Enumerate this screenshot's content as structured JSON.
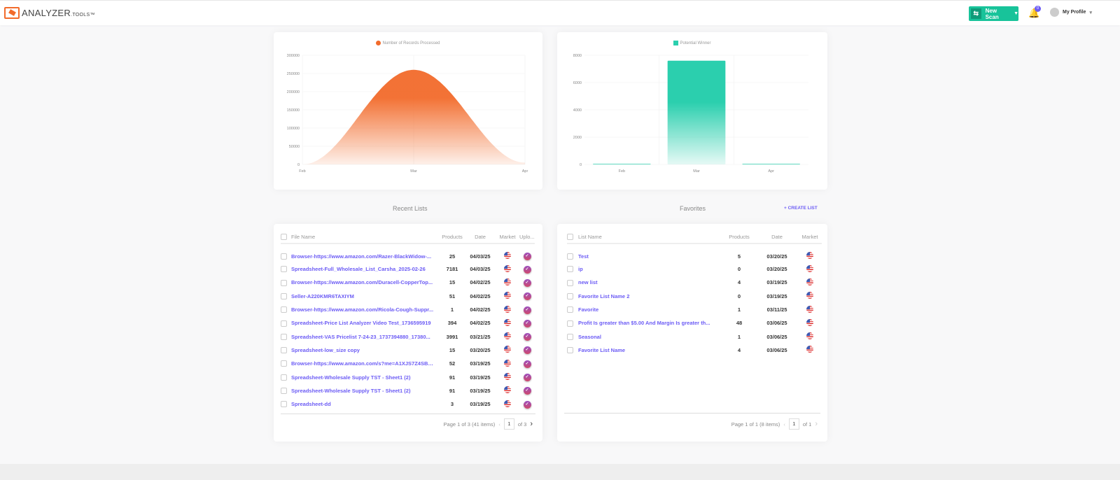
{
  "header": {
    "logo_text": "ANALYZER",
    "logo_suffix": ".TOOLS™",
    "new_scan": "New Scan",
    "notifications_count": "0",
    "profile": "My Profile"
  },
  "chart_data": [
    {
      "type": "area",
      "legend": "Number of Records Processed",
      "color": "#f26b2b",
      "categories": [
        "Feb",
        "Mar",
        "Apr"
      ],
      "values": [
        0,
        260000,
        5000
      ],
      "ylim": [
        0,
        300000
      ],
      "yticks": [
        "0",
        "50000",
        "100000",
        "150000",
        "200000",
        "250000",
        "300000"
      ],
      "grid": true,
      "legend_position": "top"
    },
    {
      "type": "bar",
      "legend": "Potential Winner",
      "color": "#2bcfae",
      "categories": [
        "Feb",
        "Mar",
        "Apr"
      ],
      "values": [
        0,
        7600,
        50
      ],
      "ylim": [
        0,
        8000
      ],
      "yticks": [
        "0",
        "2000",
        "4000",
        "6000",
        "8000"
      ],
      "grid": true,
      "legend_position": "top"
    }
  ],
  "recent": {
    "title": "Recent Lists",
    "headers": [
      "File Name",
      "Products",
      "Date",
      "Market",
      "Uplo..."
    ],
    "rows": [
      [
        "Browser-https://www.amazon.com/Razer-BlackWidow-...",
        "25",
        "04/03/25"
      ],
      [
        "Spreadsheet-Full_Wholesale_List_Carsha_2025-02-26",
        "7181",
        "04/03/25"
      ],
      [
        "Browser-https://www.amazon.com/Duracell-CopperTop...",
        "15",
        "04/02/25"
      ],
      [
        "Seller-A220KMR6TAXIYM",
        "51",
        "04/02/25"
      ],
      [
        "Browser-https://www.amazon.com/Ricola-Cough-Suppr...",
        "1",
        "04/02/25"
      ],
      [
        "Spreadsheet-Price List Analyzer Video Test_1736595919",
        "394",
        "04/02/25"
      ],
      [
        "Spreadsheet-VAS Pricelist 7-24-23_1737394880_17380...",
        "3991",
        "03/21/25"
      ],
      [
        "Spreadsheet-low_size copy",
        "15",
        "03/20/25"
      ],
      [
        "Browser-https://www.amazon.com/s?me=A1XJS7Z4SBL...",
        "52",
        "03/19/25"
      ],
      [
        "Spreadsheet-Wholesale Supply TST - Sheet1 (2)",
        "91",
        "03/19/25"
      ],
      [
        "Spreadsheet-Wholesale Supply TST - Sheet1 (2)",
        "91",
        "03/19/25"
      ],
      [
        "Spreadsheet-dd",
        "3",
        "03/19/25"
      ]
    ],
    "pager": {
      "summary": "Page 1 of 3 (41 items)",
      "page": "1",
      "of": "of 3"
    }
  },
  "favorites": {
    "title": "Favorites",
    "create": "+ CREATE LIST",
    "headers": [
      "List Name",
      "Products",
      "Date",
      "Market"
    ],
    "rows": [
      [
        "Test",
        "5",
        "03/20/25"
      ],
      [
        "ip",
        "0",
        "03/20/25"
      ],
      [
        "new list",
        "4",
        "03/19/25"
      ],
      [
        "Favorite List Name 2",
        "0",
        "03/19/25"
      ],
      [
        "Favorite",
        "1",
        "03/11/25"
      ],
      [
        "Profit Is greater than $5.00 And Margin Is greater th...",
        "48",
        "03/06/25"
      ],
      [
        "Seasonal",
        "1",
        "03/06/25"
      ],
      [
        "Favorite List Name",
        "4",
        "03/06/25"
      ]
    ],
    "pager": {
      "summary": "Page 1 of 1 (8 items)",
      "page": "1",
      "of": "of 1"
    }
  }
}
